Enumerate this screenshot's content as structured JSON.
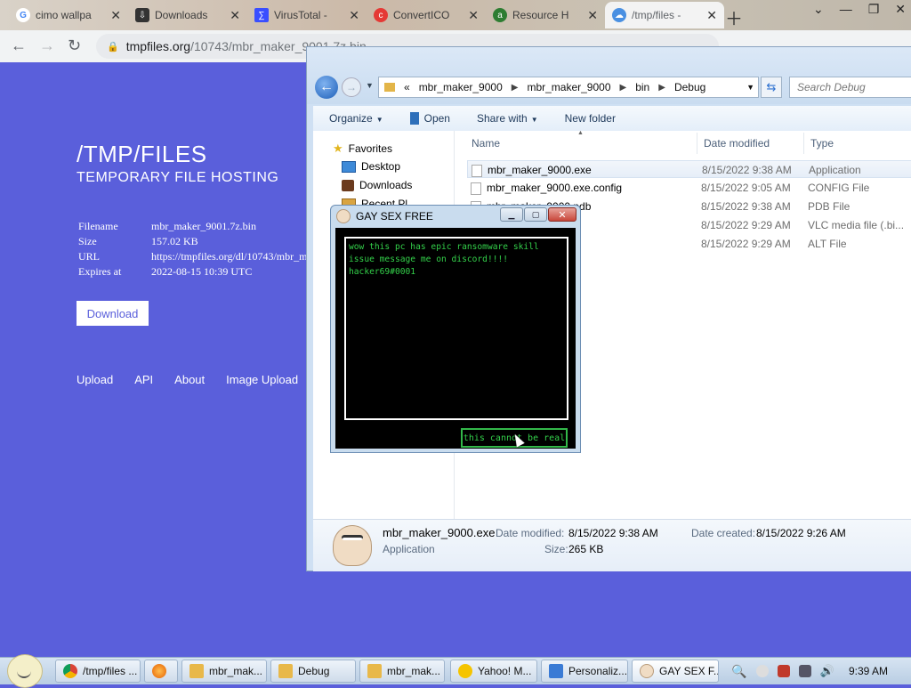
{
  "browser": {
    "tabs": [
      {
        "title": "cimo wallpa",
        "icon": "google-icon",
        "color": "#4285f4"
      },
      {
        "title": "Downloads",
        "icon": "downloads-icon",
        "color": "#333333"
      },
      {
        "title": "VirusTotal -",
        "icon": "virustotal-icon",
        "color": "#394eff"
      },
      {
        "title": "ConvertICO",
        "icon": "converter-icon",
        "color": "#e53935"
      },
      {
        "title": "Resource H",
        "icon": "resource-icon",
        "color": "#2e7d32"
      },
      {
        "title": "/tmp/files -",
        "icon": "cloud-icon",
        "color": "#4a90e2"
      }
    ],
    "url_host": "tmpfiles.org",
    "url_path": "/10743/mbr_maker_9001.7z.bin"
  },
  "site": {
    "title": "/TMP/FILES",
    "subtitle": "TEMPORARY FILE HOSTING",
    "info": [
      {
        "key": "Filename",
        "value": "mbr_maker_9001.7z.bin"
      },
      {
        "key": "Size",
        "value": "157.02 KB"
      },
      {
        "key": "URL",
        "value": "https://tmpfiles.org/dl/10743/mbr_m"
      },
      {
        "key": "Expires at",
        "value": "2022-08-15 10:39 UTC"
      }
    ],
    "download_label": "Download",
    "links": [
      "Upload",
      "API",
      "About",
      "Image Upload"
    ]
  },
  "explorer": {
    "breadcrumb": [
      "mbr_maker_9000",
      "mbr_maker_9000",
      "bin",
      "Debug"
    ],
    "breadcrumb_prefix": "«",
    "search_placeholder": "Search Debug",
    "commands": {
      "organize": "Organize",
      "open": "Open",
      "share": "Share with",
      "new_folder": "New folder"
    },
    "nav": [
      {
        "label": "Favorites",
        "icon": "star-icon"
      },
      {
        "label": "Desktop",
        "icon": "desktop-icon"
      },
      {
        "label": "Downloads",
        "icon": "downloads-folder-icon"
      },
      {
        "label": "Recent Pl",
        "icon": "recent-icon"
      }
    ],
    "columns": {
      "name": "Name",
      "date": "Date modified",
      "type": "Type"
    },
    "files": [
      {
        "name": "mbr_maker_9000.exe",
        "date": "8/15/2022 9:38 AM",
        "type": "Application",
        "selected": true
      },
      {
        "name": "mbr_maker_9000.exe.config",
        "date": "8/15/2022 9:05 AM",
        "type": "CONFIG File"
      },
      {
        "name": "mbr_maker_9000.pdb",
        "date": "8/15/2022 9:38 AM",
        "type": "PDB File"
      },
      {
        "name": "",
        "date": "8/15/2022 9:29 AM",
        "type": "VLC media file (.bi..."
      },
      {
        "name": "",
        "date": "8/15/2022 9:29 AM",
        "type": "ALT File"
      }
    ],
    "details": {
      "name": "mbr_maker_9000.exe",
      "kind": "Application",
      "modified_label": "Date modified:",
      "modified": "8/15/2022 9:38 AM",
      "created_label": "Date created:",
      "created": "8/15/2022 9:26 AM",
      "size_label": "Size:",
      "size": "265 KB"
    }
  },
  "popup": {
    "title": "GAY SEX FREE",
    "message": "wow this pc has epic ransomware skill issue message me on discord!!!! hacker69#0001",
    "button": "this cannot be real"
  },
  "taskbar": {
    "items": [
      {
        "label": "/tmp/files ...",
        "icon": "chrome-icon",
        "color": "#4285f4"
      },
      {
        "label": "",
        "icon": "firefox-icon",
        "color": "#e66000"
      },
      {
        "label": "mbr_mak...",
        "icon": "folder-icon",
        "color": "#e8b84a"
      },
      {
        "label": "Debug",
        "icon": "folder-icon",
        "color": "#e8b84a"
      },
      {
        "label": "mbr_mak...",
        "icon": "folder-icon",
        "color": "#e8b84a"
      },
      {
        "label": "Yahoo! M...",
        "icon": "yahoo-smiley-icon",
        "color": "#f5c400"
      },
      {
        "label": "Personaliz...",
        "icon": "personalize-icon",
        "color": "#3a7bd5"
      },
      {
        "label": "GAY SEX F...",
        "icon": "peter-icon",
        "color": "#f0dcc4"
      }
    ],
    "clock": "9:39 AM"
  }
}
